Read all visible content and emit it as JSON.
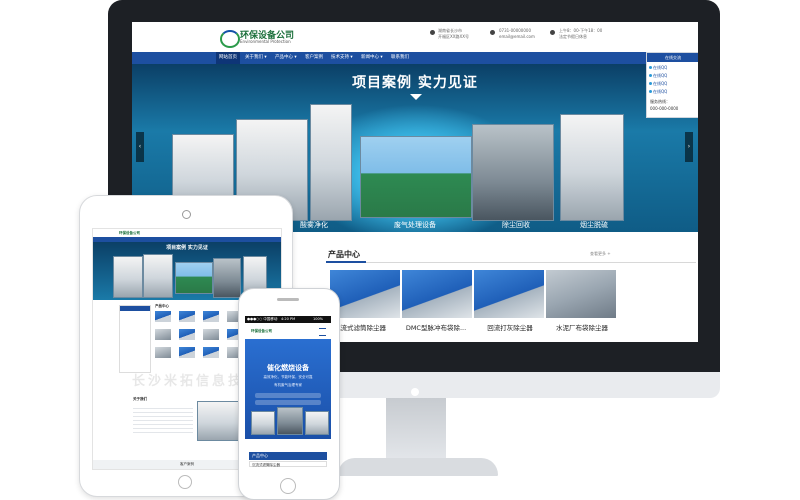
{
  "site": {
    "logo_cn": "环保设备公司",
    "logo_en": "Environmental Protection",
    "address_l1": "湖南省长沙市",
    "address_l2": "开福区XX路XX号",
    "phone": "0731-00000000",
    "email": "email@email.com",
    "hours_l1": "上午8：00-下午18：00",
    "hours_l2": "法定节假日休息"
  },
  "nav": {
    "items": [
      "网站首页",
      "关于我们 ▾",
      "产品中心 ▾",
      "客户案例",
      "技术支持 ▾",
      "新闻中心 ▾",
      "联系我们"
    ]
  },
  "hero": {
    "title": "项目案例 实力见证",
    "captions": [
      "酸雾净化",
      "废气处理设备",
      "除尘回收",
      "烟尘脱硫"
    ],
    "prev": "‹",
    "next": "›"
  },
  "service": {
    "title": "在线交流",
    "qq": [
      "在线QQ",
      "在线QQ",
      "在线QQ",
      "在线QQ"
    ],
    "hotline_label": "服务热线：",
    "hotline": "000-000-0000"
  },
  "products": {
    "title": "产品中心",
    "more": "查看更多 +",
    "items": [
      "沉流式滤筒除尘器",
      "DMC型脉冲布袋除...",
      "回流打灰除尘器",
      "水泥厂布袋除尘器"
    ]
  },
  "tablet": {
    "hero_title": "项目案例 实力见证",
    "section_title": "产品中心",
    "about_title": "关于我们",
    "footer": "客户案例"
  },
  "phone": {
    "status_left": "●●●○○ 中国移动",
    "status_time": "4:20 PM",
    "status_right": "100%",
    "hero_title": "催化燃烧设备",
    "hero_sub1": "高效净化，节能环保，安全可靠",
    "hero_sub2": "有机废气治理专家",
    "section_title": "产品中心",
    "row1": "沉流式滤筒除尘器"
  },
  "watermark": "长沙米拓信息技术"
}
